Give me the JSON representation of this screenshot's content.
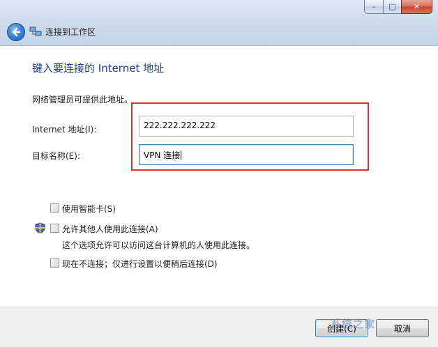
{
  "window": {
    "title": "连接到工作区",
    "controls": {
      "minimize": "–",
      "maximize": "□",
      "close": "✕"
    },
    "back_icon": "back-arrow-icon"
  },
  "content": {
    "heading": "键入要连接的 Internet 地址",
    "description": "网络管理员可提供此地址。",
    "address_label": "Internet 地址(I):",
    "address_value": "222.222.222.222",
    "destination_label": "目标名称(E):",
    "destination_value": "VPN 连接",
    "options": {
      "smart_card": "使用智能卡(S)",
      "allow_others": "允许其他人使用此连接(A)",
      "allow_others_desc": "这个选项允许可以访问这台计算机的人使用此连接。",
      "connect_later": "现在不连接；仅进行设置以便稍后连接(D)"
    }
  },
  "footer": {
    "connect_button": "创建(C)",
    "cancel_button": "取消"
  },
  "watermark": "系统之家",
  "colors": {
    "heading": "#1e3b8a",
    "highlight": "#d93030"
  }
}
